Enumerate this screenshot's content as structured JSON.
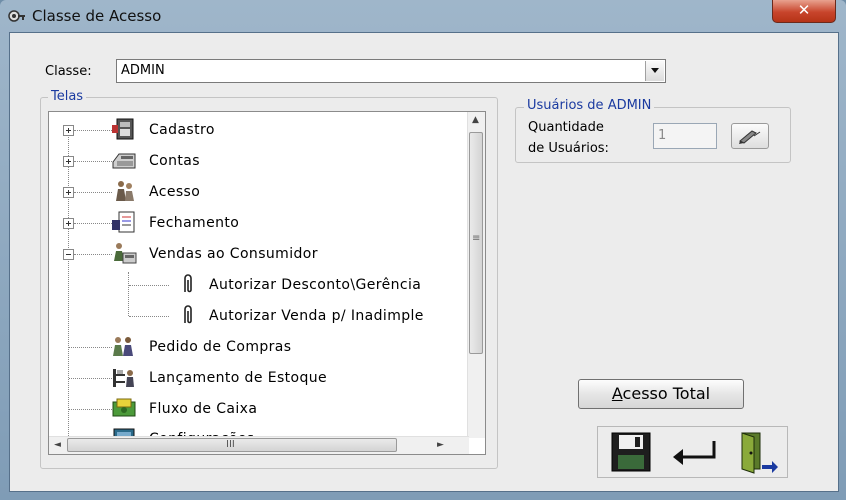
{
  "window": {
    "title": "Classe de Acesso",
    "close_glyph": "✕"
  },
  "classe": {
    "label": "Classe:",
    "value": "ADMIN"
  },
  "telas": {
    "legend": "Telas",
    "items": [
      {
        "label": "Cadastro",
        "expander": "plus",
        "icon": "cash-register-icon"
      },
      {
        "label": "Contas",
        "expander": "plus",
        "icon": "calculator-icon"
      },
      {
        "label": "Acesso",
        "expander": "plus",
        "icon": "people-icon"
      },
      {
        "label": "Fechamento",
        "expander": "plus",
        "icon": "document-report-icon"
      },
      {
        "label": "Vendas ao Consumidor",
        "expander": "minus",
        "icon": "sales-clerk-icon"
      },
      {
        "label": "Autorizar Desconto\\Gerência",
        "child": true,
        "icon": "paperclip-icon"
      },
      {
        "label": "Autorizar Venda p/ Inadimple",
        "child": true,
        "icon": "paperclip-icon"
      },
      {
        "label": "Pedido de Compras",
        "icon": "people-order-icon"
      },
      {
        "label": "Lançamento de Estoque",
        "icon": "warehouse-icon"
      },
      {
        "label": "Fluxo de Caixa",
        "icon": "money-icon"
      },
      {
        "label": "Configurações",
        "icon": "monitor-icon"
      }
    ],
    "hscroll_glyph": "III",
    "vscroll_glyph": "≡"
  },
  "usuarios": {
    "legend": "Usuários de ADMIN",
    "qtd_line1": "Quantidade",
    "qtd_line2": "de Usuários:",
    "qtd_value": "1"
  },
  "buttons": {
    "acesso_total_prefix": "A",
    "acesso_total_rest": "cesso Total"
  },
  "colors": {
    "legend_blue": "#1a3aa0",
    "close_red": "#c8452c"
  }
}
